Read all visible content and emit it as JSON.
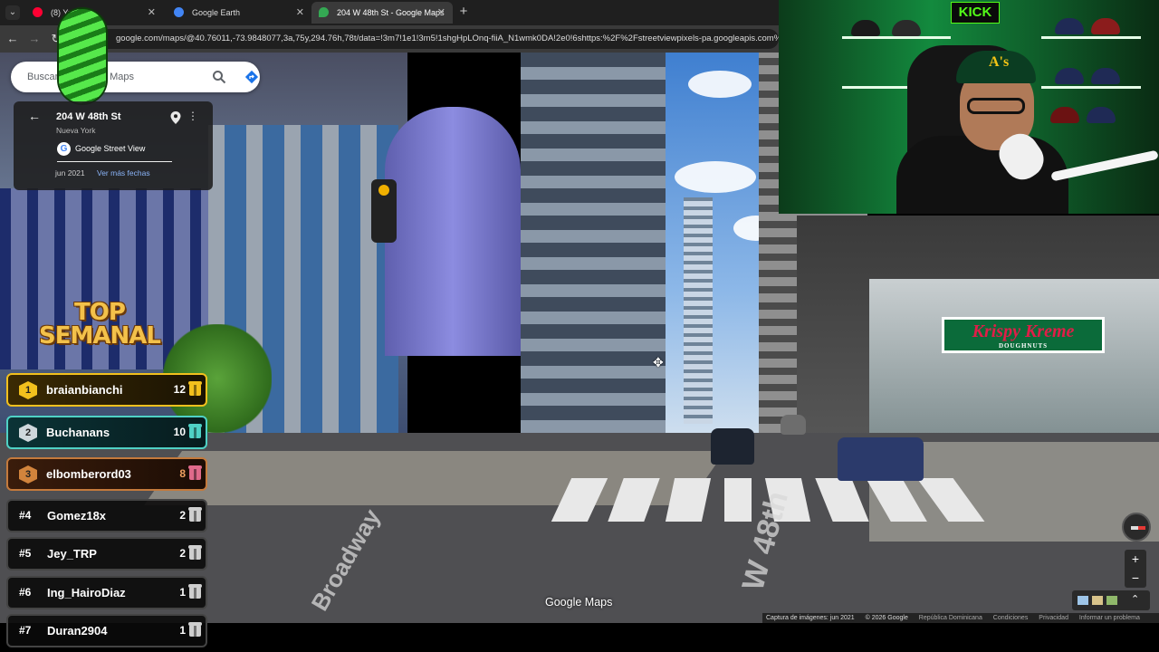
{
  "browser": {
    "tabs": [
      {
        "label": "(8) YouT",
        "favicon": "youtube-icon",
        "color": "#ff0033"
      },
      {
        "label": "Google Earth",
        "favicon": "earth-icon",
        "color": "#4285f4"
      },
      {
        "label": "204 W 48th St - Google Maps",
        "favicon": "maps-pin-icon",
        "color": "#34a853"
      }
    ],
    "new_tab": "+",
    "close_glyph": "✕",
    "url": "google.com/maps/@40.76011,-73.9848077,3a,75y,294.76h,78t/data=!3m7!1e1!3m5!1shgHpLOnq-fiiA_N1wmk0DA!2e0!6shttps:%2F%2Fstreetviewpixels-pa.googleapis.com%2Fv1%"
  },
  "maps": {
    "search_placeholder": "Buscar en Google Maps",
    "place_title": "204 W 48th St",
    "place_subtitle": "Nueva York",
    "source_label": "Google Street View",
    "capture_date": "jun 2021",
    "more_dates_link": "Ver más fechas",
    "brand": "Google Maps",
    "footer": {
      "capture": "Captura de imágenes: jun 2021",
      "copyright": "© 2026 Google",
      "region": "República Dominicana",
      "terms": "Condiciones",
      "privacy": "Privacidad",
      "report": "Informar un problema"
    },
    "zoom_in": "+",
    "zoom_out": "−"
  },
  "scene": {
    "store_sign": "Krispy Kreme",
    "store_sign_sub": "DOUGHNUTS",
    "road_label_1": "W 48th",
    "road_label_2": "Broadway"
  },
  "stream": {
    "ranking_title": "TOP SEMANAL",
    "ranking": [
      {
        "pos": "1",
        "name": "braianbianchi",
        "count": "12",
        "color": "#f2c01d"
      },
      {
        "pos": "2",
        "name": "Buchanans",
        "count": "10",
        "color": "#4fd1c5"
      },
      {
        "pos": "3",
        "name": "elbomberord03",
        "count": "8",
        "color": "#d2843c"
      },
      {
        "pos": "#4",
        "name": "Gomez18x",
        "count": "2",
        "color": "#cfcfcf"
      },
      {
        "pos": "#5",
        "name": "Jey_TRP",
        "count": "2",
        "color": "#cfcfcf"
      },
      {
        "pos": "#6",
        "name": "Ing_HairoDiaz",
        "count": "1",
        "color": "#cfcfcf"
      },
      {
        "pos": "#7",
        "name": "Duran2904",
        "count": "1",
        "color": "#cfcfcf"
      }
    ],
    "cam_sign": "KICK",
    "hat_logo": "A's"
  }
}
